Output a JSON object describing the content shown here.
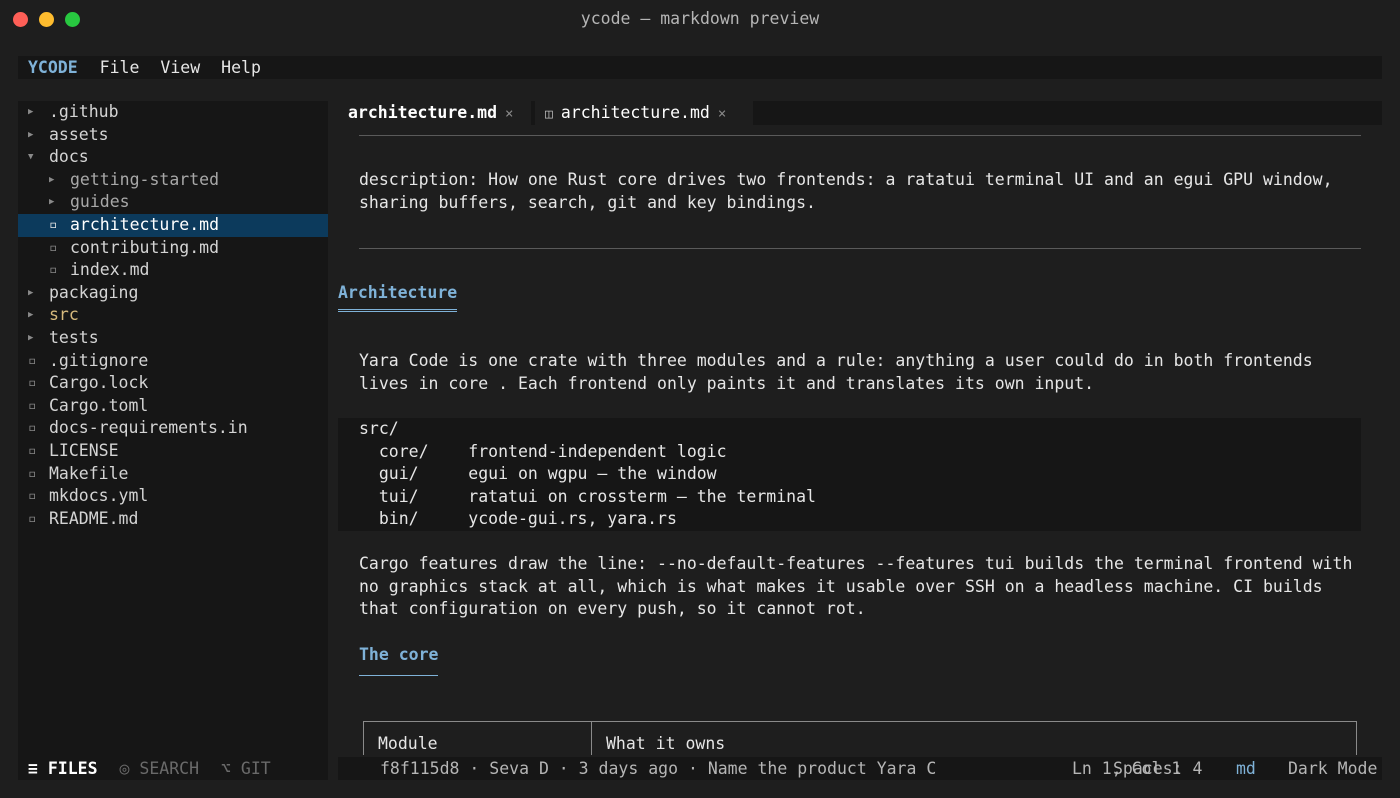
{
  "window": {
    "title": "ycode — markdown preview"
  },
  "menubar": {
    "brand": "YCODE",
    "items": [
      "File",
      "View",
      "Help"
    ]
  },
  "tree": [
    {
      "name": ".github",
      "kind": "folder",
      "expanded": false,
      "depth": 0
    },
    {
      "name": "assets",
      "kind": "folder",
      "expanded": false,
      "depth": 0
    },
    {
      "name": "docs",
      "kind": "folder",
      "expanded": true,
      "depth": 0
    },
    {
      "name": "getting-started",
      "kind": "folder",
      "expanded": false,
      "depth": 1
    },
    {
      "name": "guides",
      "kind": "folder",
      "expanded": false,
      "depth": 1
    },
    {
      "name": "architecture.md",
      "kind": "file",
      "depth": 1,
      "selected": true
    },
    {
      "name": "contributing.md",
      "kind": "file",
      "depth": 1
    },
    {
      "name": "index.md",
      "kind": "file",
      "depth": 1
    },
    {
      "name": "packaging",
      "kind": "folder",
      "expanded": false,
      "depth": 0
    },
    {
      "name": "src",
      "kind": "folder",
      "expanded": false,
      "depth": 0,
      "modified": true
    },
    {
      "name": "tests",
      "kind": "folder",
      "expanded": false,
      "depth": 0
    },
    {
      "name": ".gitignore",
      "kind": "file",
      "depth": 0
    },
    {
      "name": "Cargo.lock",
      "kind": "file",
      "depth": 0
    },
    {
      "name": "Cargo.toml",
      "kind": "file",
      "depth": 0
    },
    {
      "name": "docs-requirements.in",
      "kind": "file",
      "depth": 0
    },
    {
      "name": "LICENSE",
      "kind": "file",
      "depth": 0
    },
    {
      "name": "Makefile",
      "kind": "file",
      "depth": 0
    },
    {
      "name": "mkdocs.yml",
      "kind": "file",
      "depth": 0
    },
    {
      "name": "README.md",
      "kind": "file",
      "depth": 0
    }
  ],
  "sidebar_tabs": {
    "files": "≡ FILES",
    "search": "◎ SEARCH",
    "git": "⌥ GIT"
  },
  "tabs": [
    {
      "label": "architecture.md",
      "close": "×",
      "active": true
    },
    {
      "label": "architecture.md",
      "close": "×",
      "icon": "◫"
    }
  ],
  "doc": {
    "description": "description: How one Rust core drives two frontends: a ratatui terminal UI and an egui GPU window, sharing buffers, search, git and key bindings.",
    "h1": "Architecture",
    "intro": "Yara Code is one crate with three modules and a rule: anything a user could do in both frontends lives in core . Each frontend only paints it and translates its own input.",
    "code": [
      "src/",
      "  core/    frontend-independent logic",
      "  gui/     egui on wgpu — the window",
      "  tui/     ratatui on crossterm — the terminal",
      "  bin/     ycode-gui.rs, yara.rs"
    ],
    "features": "Cargo features draw the line: --no-default-features --features tui builds the terminal frontend with no graphics stack at all, which is what makes it usable over SSH on a headless machine. CI builds that configuration on every push, so it cannot rot.",
    "h2": "The core",
    "table_headers": [
      "Module",
      "What it owns"
    ]
  },
  "status": {
    "commit": "f8f115d8 · Seva D · 3 days ago · Name the product Yara C",
    "position": "Ln 1, Col 1",
    "spaces": "Spaces: 4",
    "language": "md",
    "theme": "Dark Mode"
  },
  "colors": {
    "accent": "#7fb2d8",
    "selection": "#0c3a5c",
    "modified": "#d7ba7d",
    "panel": "#161616",
    "background": "#1e1e1e"
  }
}
